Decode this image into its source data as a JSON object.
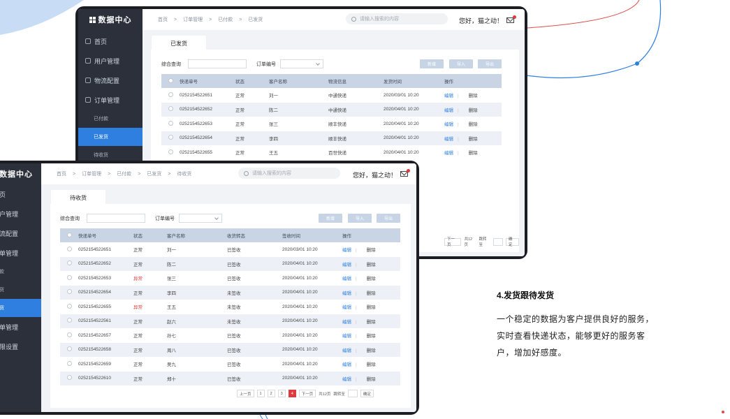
{
  "caption": {
    "title": "4.发货跟待发货",
    "lines": [
      "一个稳定的数据为客户提供良好的服务，",
      "实时查看快递状态，能够更好的服务客",
      "户，增加好感度。"
    ]
  },
  "colors": {
    "accent": "#2e7fe0",
    "danger": "#e03a3a",
    "sidebar": "#2b303b",
    "header_row": "#c9d5e4"
  },
  "back_screen": {
    "logo": "数据中心",
    "nav": [
      {
        "label": "首页",
        "icon": "home-icon"
      },
      {
        "label": "用户管理",
        "icon": "user-icon"
      },
      {
        "label": "物流配置",
        "icon": "truck-icon"
      },
      {
        "label": "订单管理",
        "icon": "order-icon"
      }
    ],
    "subnav": [
      "已付款",
      "已发货",
      "待收货"
    ],
    "breadcrumb": [
      "首页",
      ">",
      "订单管理",
      ">",
      "已付款",
      ">",
      "已发货"
    ],
    "search_placeholder": "请输入搜索的内容",
    "greeting": "您好，猫之动！",
    "tab": "已发货",
    "filter": {
      "query_label": "综合查询",
      "order_label": "订单编号"
    },
    "buttons": [
      "新增",
      "导入",
      "导出"
    ],
    "columns": [
      "快递单号",
      "状态",
      "客户名称",
      "物流信息",
      "发货时间",
      "操作"
    ],
    "rows": [
      [
        "0252154522651",
        "正常",
        "刘一",
        "中通快递",
        "2020/03/01  10:20"
      ],
      [
        "0252154522652",
        "正常",
        "陈二",
        "中通快递",
        "2020/04/01  10:20"
      ],
      [
        "0252154522653",
        "正常",
        "张三",
        "顺丰快递",
        "2020/04/01  10:20"
      ],
      [
        "0252154522654",
        "正常",
        "李四",
        "顺丰快递",
        "2020/04/01  10:20"
      ],
      [
        "0252154522655",
        "正常",
        "王五",
        "百世快递",
        "2020/04/01  10:20"
      ]
    ],
    "edit": "编辑",
    "delete": "删除",
    "pager": {
      "next": "下一页",
      "total": "共12页",
      "goto": "跳转至",
      "confirm": "确定"
    }
  },
  "front_screen": {
    "logo": "数据中心",
    "nav_partial": [
      "页",
      "户管理",
      "流配置",
      "单管理"
    ],
    "sub_partial": [
      "款",
      "货",
      "货"
    ],
    "nav_partial_bottom": [
      "单管理",
      "限设置"
    ],
    "breadcrumb": [
      "首页",
      ">",
      "订单管理",
      ">",
      "已付款",
      ">",
      "已发货",
      ">",
      "待收货"
    ],
    "search_placeholder": "请输入搜索的内容",
    "greeting": "您好，猫之动！",
    "tab": "待收货",
    "filter": {
      "query_label": "综合查询",
      "order_label": "订单编号"
    },
    "buttons": [
      "新增",
      "导入",
      "导出"
    ],
    "columns": [
      "快递单号",
      "状态",
      "客户名称",
      "收货转态",
      "签收时间",
      "操作"
    ],
    "rows": [
      [
        "0252154522651",
        "正常",
        "刘一",
        "已签收",
        "2020/03/01  10:20"
      ],
      [
        "0252154522652",
        "正常",
        "陈二",
        "已签收",
        "2020/04/01  10:20"
      ],
      [
        "0252154522653",
        "异常",
        "张三",
        "已签收",
        "2020/04/01  10:20"
      ],
      [
        "0252154522654",
        "正常",
        "李四",
        "未签收",
        "2020/04/01  10:20"
      ],
      [
        "0252154522655",
        "异常",
        "王五",
        "未签收",
        "2020/04/01  10:20"
      ],
      [
        "0252154522561",
        "正常",
        "赵六",
        "未签收",
        "2020/04/01  10:20"
      ],
      [
        "0252154522657",
        "正常",
        "孙七",
        "已签收",
        "2020/04/01  10:20"
      ],
      [
        "0252154522658",
        "正常",
        "周八",
        "已签收",
        "2020/04/01  10:20"
      ],
      [
        "0252154522659",
        "正常",
        "吴九",
        "已签收",
        "2020/04/01  10:20"
      ],
      [
        "0252154522610",
        "正常",
        "郑十",
        "已签收",
        "2020/04/01  10:20"
      ]
    ],
    "edit": "编辑",
    "delete": "删除",
    "pager": {
      "prev": "上一页",
      "pages": [
        "1",
        "2",
        "3",
        "4"
      ],
      "current": "4",
      "next": "下一页",
      "total": "共12页",
      "goto": "跳转至",
      "confirm": "确定"
    }
  }
}
